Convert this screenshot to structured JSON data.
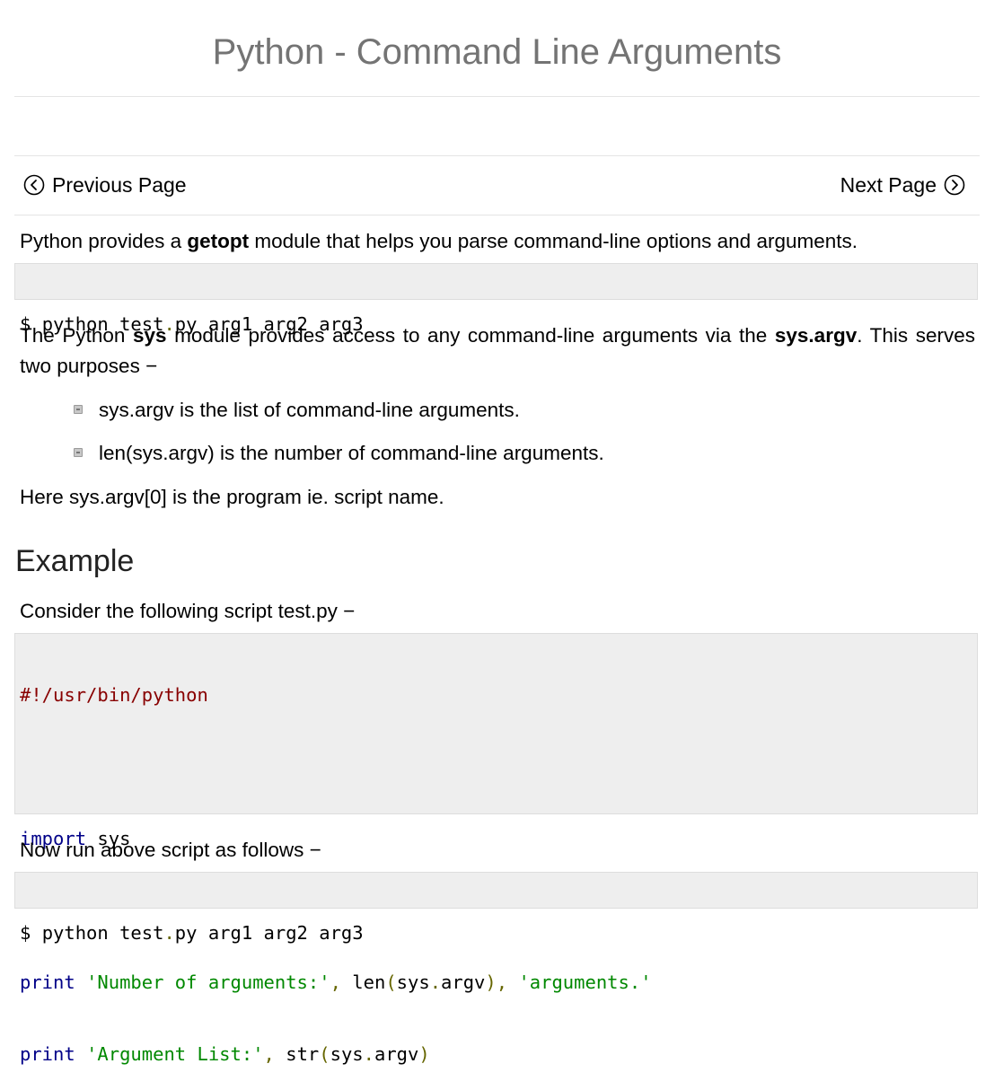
{
  "page": {
    "title": "Python - Command Line Arguments"
  },
  "nav": {
    "previous_label": "Previous Page",
    "next_label": "Next Page",
    "previous_icon": "circle-chevron-left-icon",
    "next_icon": "circle-chevron-right-icon"
  },
  "intro": {
    "prefix": "Python provides a ",
    "bold": "getopt",
    "suffix": " module that helps you parse command-line options and arguments."
  },
  "command1": {
    "dollar": "$ ",
    "cmd": "python test",
    "dot": ".",
    "rest": "py arg1 arg2 arg3"
  },
  "sys_para": {
    "part1": "The Python ",
    "bold1": "sys",
    "part2": " module provides access to any command-line arguments via the ",
    "bold2": "sys.argv",
    "part3": ". This serves two purposes −"
  },
  "bullets": [
    "sys.argv is the list of command-line arguments.",
    "len(sys.argv) is the number of command-line arguments."
  ],
  "argv0_note": "Here sys.argv[0] is the program ie. script name.",
  "example": {
    "heading": "Example",
    "consider": "Consider the following script test.py −",
    "code": {
      "shebang": "#!/usr/bin/python",
      "import_kw": "import",
      "import_mod": " sys",
      "print1_kw": "print",
      "print1_str1": "'Number of arguments:'",
      "print1_comma1": ",",
      "print1_len": " len",
      "print1_paren_open": "(",
      "print1_sys": "sys",
      "print1_dot": ".",
      "print1_argv": "argv",
      "print1_paren_close": "),",
      "print1_str2": "'arguments.'",
      "print2_kw": "print",
      "print2_str": "'Argument List:'",
      "print2_comma": ",",
      "print2_str_fn": " str",
      "print2_paren_open": "(",
      "print2_sys": "sys",
      "print2_dot": ".",
      "print2_argv": "argv",
      "print2_paren_close": ")"
    },
    "run_note": "Now run above script as follows −"
  },
  "command2": {
    "dollar": "$ ",
    "cmd": "python test",
    "dot": ".",
    "rest": "py arg1 arg2 arg3"
  },
  "colors": {
    "title": "#747474",
    "code_bg": "#eeeeee",
    "code_keyword": "#000088",
    "code_string": "#008800",
    "code_comment": "#880000",
    "code_punct": "#666600"
  }
}
